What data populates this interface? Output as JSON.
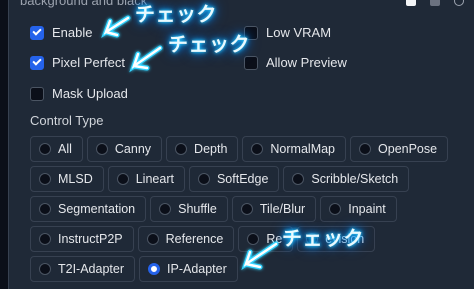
{
  "header": {
    "cut_text": "background and black"
  },
  "checkboxes": {
    "enable": {
      "label": "Enable",
      "checked": true
    },
    "pixel_perfect": {
      "label": "Pixel Perfect",
      "checked": true
    },
    "mask_upload": {
      "label": "Mask Upload",
      "checked": false
    },
    "low_vram": {
      "label": "Low VRAM",
      "checked": false
    },
    "allow_preview": {
      "label": "Allow Preview",
      "checked": false
    }
  },
  "control_type": {
    "label": "Control Type",
    "selected": "IP-Adapter",
    "rows": [
      [
        "All",
        "Canny",
        "Depth",
        "NormalMap",
        "OpenPose"
      ],
      [
        "MLSD",
        "Lineart",
        "SoftEdge",
        "Scribble/Sketch"
      ],
      [
        "Segmentation",
        "Shuffle",
        "Tile/Blur",
        "Inpaint"
      ],
      [
        "InstructP2P",
        "Reference",
        "Re",
        "evision"
      ],
      [
        "T2I-Adapter",
        "IP-Adapter"
      ]
    ]
  },
  "annotations": {
    "badge_1": "チェック",
    "badge_2": "チェック",
    "badge_3": "チェック"
  },
  "colors": {
    "accent": "#2563eb",
    "panel": "#1f2937",
    "glow": "#33d4ff"
  }
}
